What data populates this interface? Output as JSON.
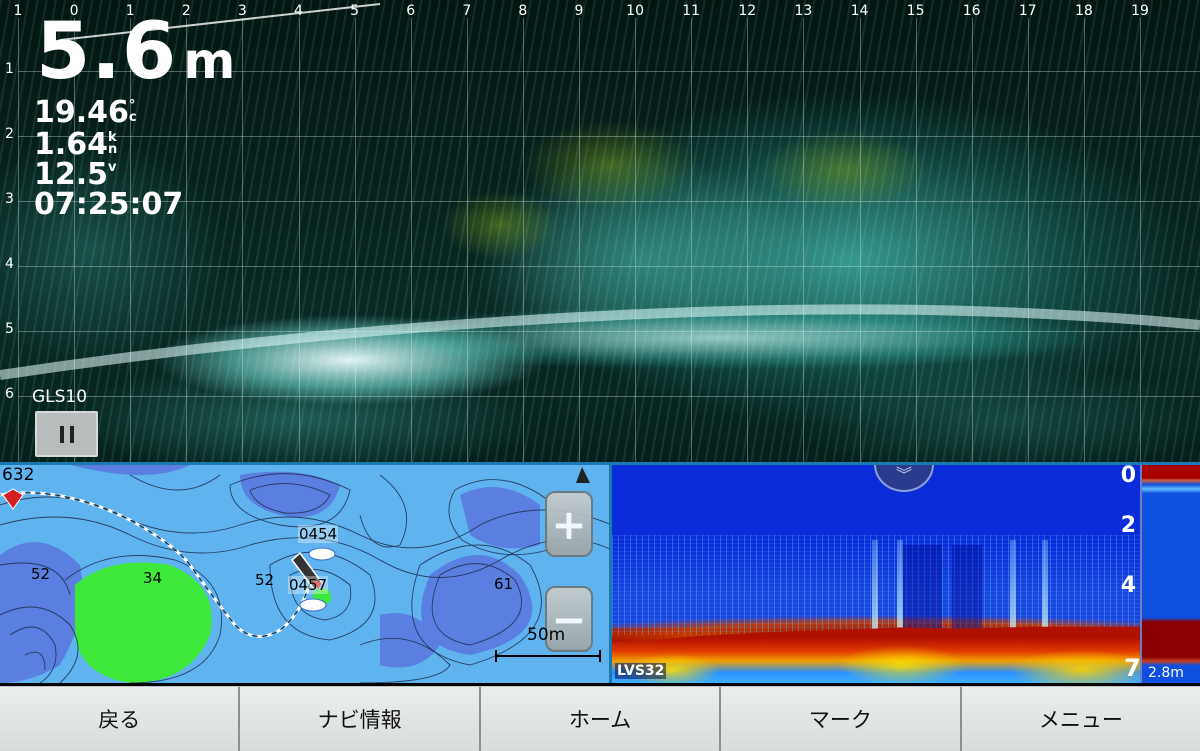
{
  "sonar": {
    "depth_value": "5.6",
    "depth_unit": "m",
    "water_temp": "19.46",
    "water_temp_unit": "°c",
    "speed": "1.64",
    "speed_unit": "kn",
    "voltage": "12.5",
    "voltage_unit": "v",
    "time": "07:25:07",
    "source_label": "GLS10",
    "x_ticks": [
      "1",
      "0",
      "1",
      "2",
      "3",
      "4",
      "5",
      "6",
      "7",
      "8",
      "9",
      "10",
      "11",
      "12",
      "13",
      "14",
      "15",
      "16",
      "17",
      "18",
      "19"
    ],
    "y_ticks": [
      "1",
      "2",
      "3",
      "4",
      "5",
      "6"
    ],
    "colors": {
      "echo": "#5fd6cc",
      "background": "#06201b"
    }
  },
  "map": {
    "count_label": "632",
    "waypoint_labels": [
      "0454",
      "0457"
    ],
    "contour_labels": [
      "52",
      "34",
      "52",
      "61"
    ],
    "scale_label": "50m",
    "zoom_in_label": "+",
    "zoom_out_label": "−",
    "colors": {
      "water": "#5fb4f0",
      "deep": "#5a7fe0",
      "shallow": "#3ee83a"
    }
  },
  "echo": {
    "depth_ticks": [
      "0",
      "2",
      "4"
    ],
    "range_value": "7",
    "range_sub": "2.8m",
    "source_label": "LVS32",
    "expand_icon": "double-chevron-down-icon"
  },
  "softkeys": [
    {
      "label": "戻る"
    },
    {
      "label": "ナビ情報"
    },
    {
      "label": "ホーム"
    },
    {
      "label": "マーク"
    },
    {
      "label": "メニュー"
    }
  ]
}
